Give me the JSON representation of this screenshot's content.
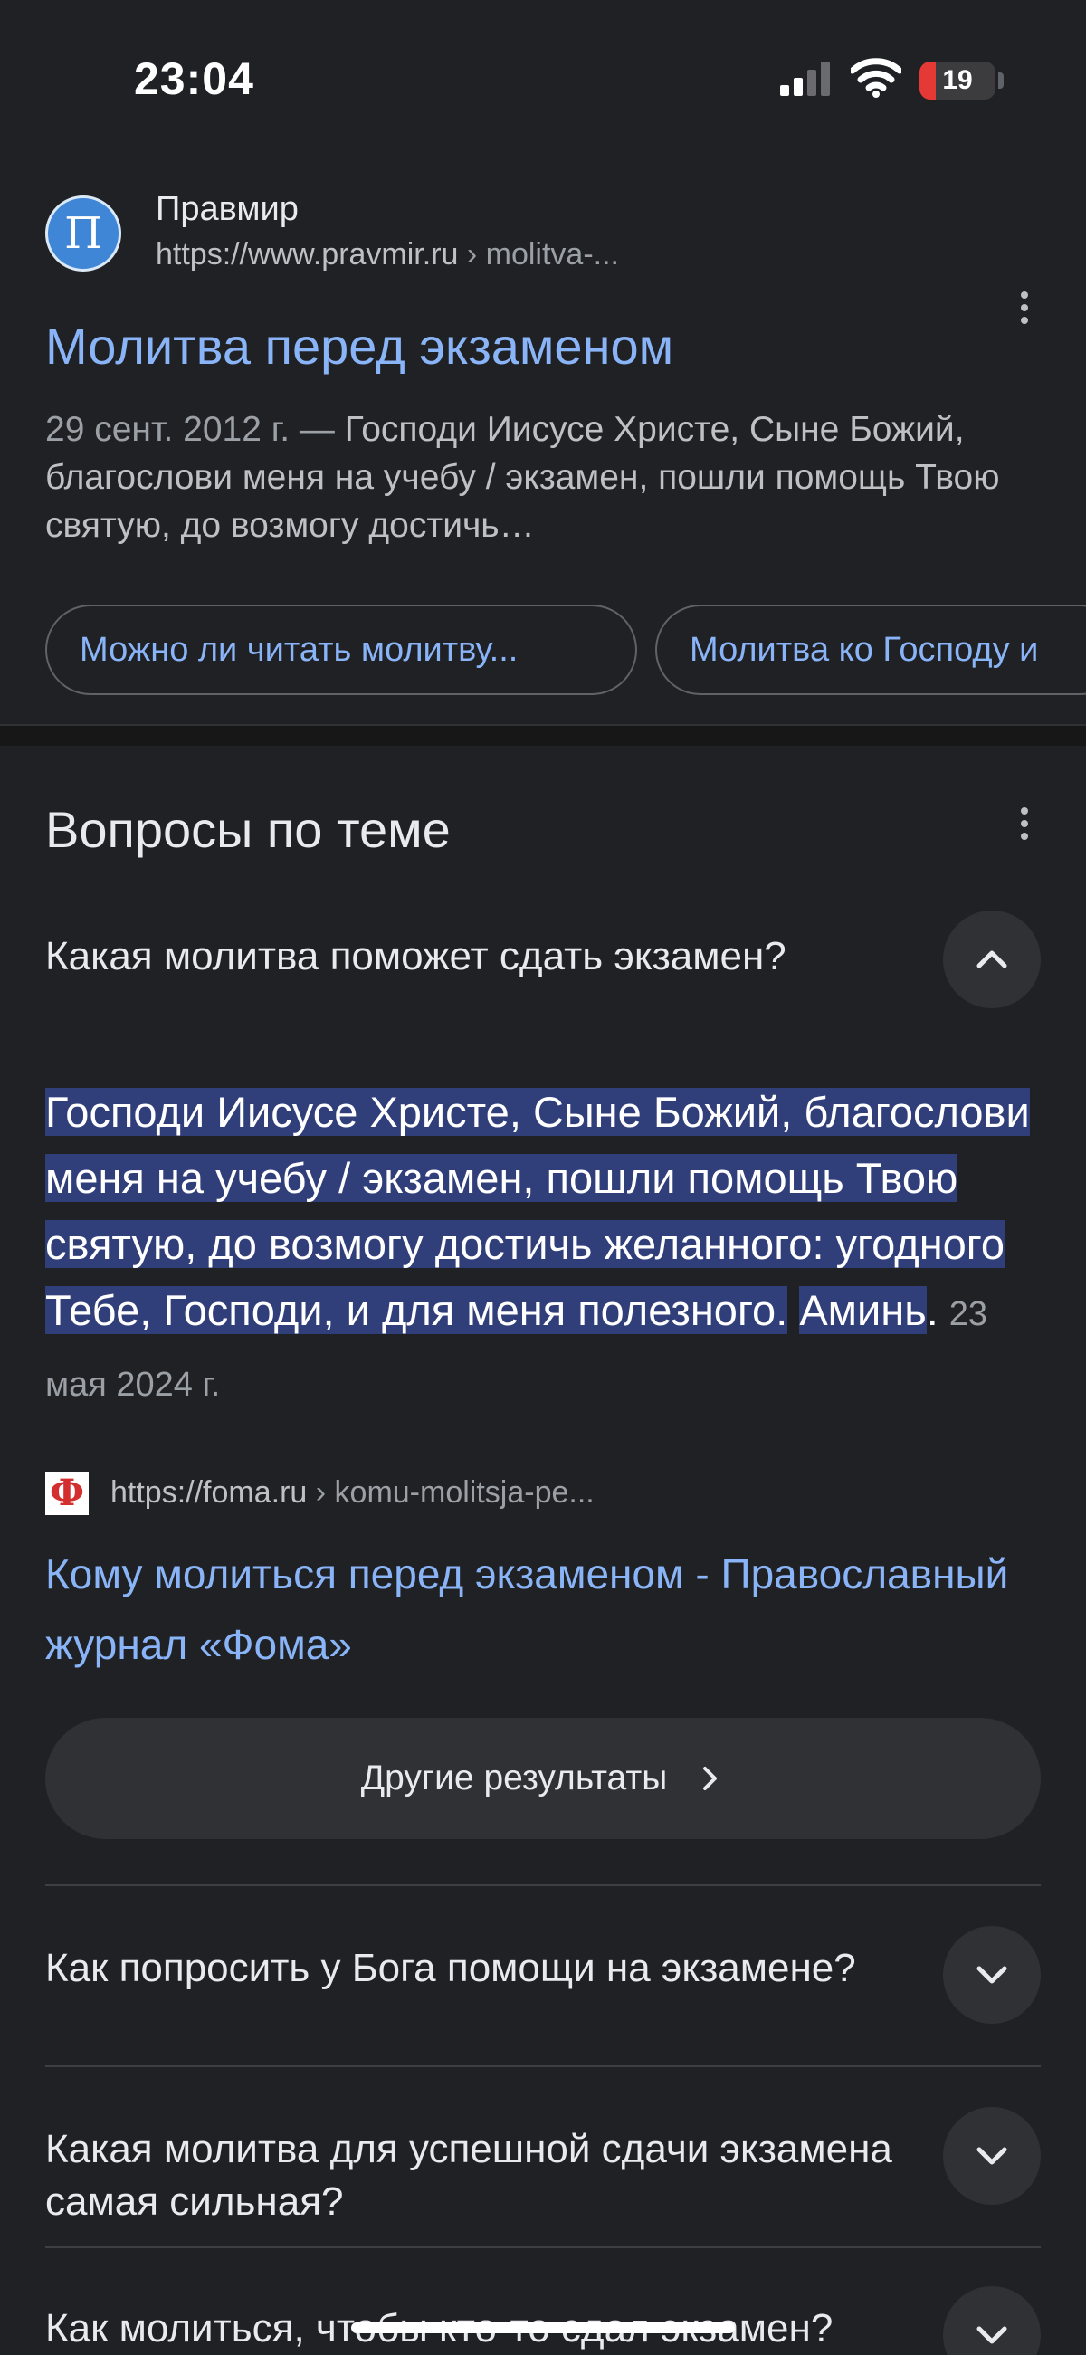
{
  "status_bar": {
    "time": "23:04",
    "battery_level": "19",
    "icons": [
      "signal-icon",
      "wifi-icon",
      "battery-icon"
    ]
  },
  "result": {
    "site_name": "Правмир",
    "favicon_letter": "П",
    "url": "https://www.pravmir.ru",
    "url_path": " › molitva-...",
    "title": "Молитва перед экзаменом",
    "snippet_date": "29 сент. 2012 г. — ",
    "snippet_text": "Господи Иисусе Христе, Сыне Божий, благослови меня на учебу / экзамен, пошли помощь Твою святую, до возмогу достичь…",
    "chips": [
      "Можно ли читать молитву...",
      "Молитва ко Господу и"
    ]
  },
  "related_questions": {
    "title": "Вопросы по теме",
    "expanded": {
      "question": "Какая молитва поможет сдать экзамен?",
      "answer_main": "Господи Иисусе Христе, Сыне Божий, благослови меня на учебу / экзамен, пошли помощь Твою святую, до возмогу достичь желанного: угодного Тебе, Господи, и для меня полезного.",
      "answer_tail": "Аминь",
      "answer_end": ".",
      "answer_date": "23 мая 2024 г.",
      "source_favicon_letter": "Ф",
      "source_url": "https://foma.ru",
      "source_url_path": " › komu-molitsja-pe...",
      "source_title": "Кому молиться перед экзаменом - Православный журнал «Фома»",
      "more_results_label": "Другие результаты"
    },
    "collapsed": [
      "Как попросить у Бога помощи на экзамене?",
      "Какая молитва для успешной сдачи экзамена самая сильная?",
      "Как молиться, чтобы кто-то сдал экзамен?"
    ]
  },
  "colors": {
    "background": "#202124",
    "link": "#8ab4f8",
    "highlight": "#303e7a",
    "battery_low": "#e53935"
  }
}
